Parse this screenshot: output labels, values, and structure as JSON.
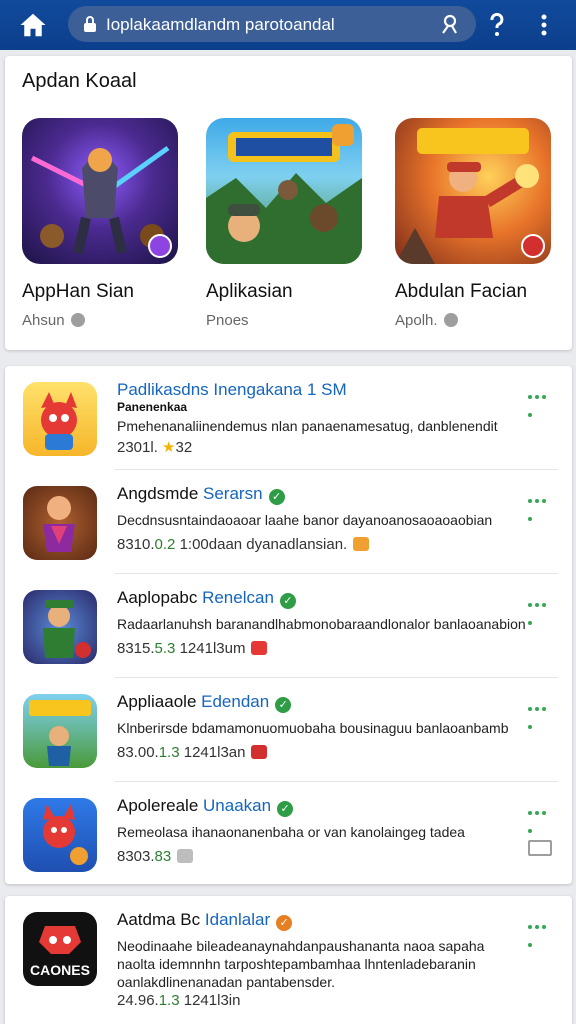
{
  "topbar": {
    "url": "Ioplakaamdlandm  parotoandal",
    "home_icon": "home-icon",
    "lock_icon": "lock-icon",
    "account_icon": "account-search-icon",
    "help_icon": "help-icon",
    "more_icon": "more-vert-icon"
  },
  "featured": {
    "title": "Apdan Koaal",
    "items": [
      {
        "name": "AppHan Sian",
        "sub": "Ahsun"
      },
      {
        "name": "Aplikasian",
        "sub": "Pnoes"
      },
      {
        "name": "Abdulan Facian",
        "sub": "Apolh."
      }
    ]
  },
  "list": [
    {
      "title": "Padlikasdns Inengakana 1 SM",
      "subtitle": "Panenenkaa",
      "desc": "Pmehenanaliinendemus nlan panaenamesatug, danblenendit",
      "meta": "2301l.",
      "rating": "32"
    },
    {
      "title": "Angdsmde",
      "blue": "Serarsn",
      "desc": "Decdnsusntaindaoaoar laahe banor dayanoanosaoaoaobian",
      "meta_a": "8310.",
      "meta_g": "0.2",
      "meta_b": "1:00daan dyanadlansian."
    },
    {
      "title": "Aaplopabc",
      "blue": "Renelcan",
      "desc": "Radaarlanuhsh baranandlhabmonobaraandlonalor banlaoanabion",
      "meta_a": "8315.",
      "meta_g": "5.3",
      "meta_b": "1241l3um"
    },
    {
      "title": "Appliaaole",
      "blue": "Edendan",
      "desc": "Klnberirsde bdamamonuomuobaha bousinaguu banlaoanbamb",
      "meta_a": "83.00.",
      "meta_g": "1.3",
      "meta_b": "1241l3an"
    },
    {
      "title": "Apolereale",
      "blue": "Unaakan",
      "desc": "Remeolasa ihanaonanenbaha or van kanolaingeg tadea",
      "meta_a": "8303.",
      "meta_g": "83"
    }
  ],
  "last": {
    "title": "Aatdma Bc",
    "blue": "Idanlalar",
    "desc1": "Neodinaahe bileadeanaynahdanpaushananta naoa sapaha",
    "desc2": "naolta idemnnhn tarposhtepambamhaa lhntenladebaranin",
    "desc3": "oanlakdlinenanadan pantabensder.",
    "meta_a": "24.96.",
    "meta_g": "1.3",
    "meta_b": "1241l3in",
    "icon_label": "CAONES"
  },
  "colors": {
    "topbar": "#114a9c",
    "accent_blue": "#1565c0",
    "green": "#34a853"
  }
}
